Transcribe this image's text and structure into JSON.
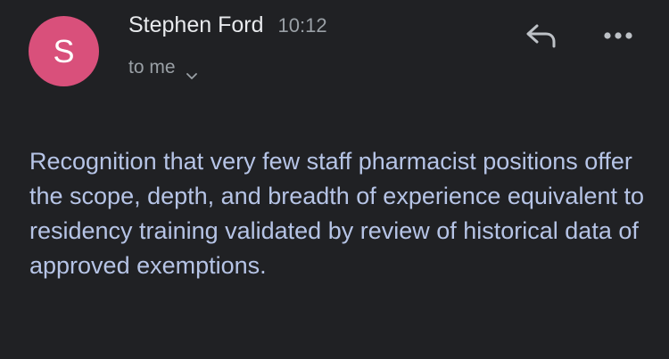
{
  "message": {
    "sender": {
      "initial": "S",
      "name": "Stephen Ford",
      "avatar_color": "#d9507b"
    },
    "time": "10:12",
    "recipient": "to me",
    "body": "Recognition that very few staff pharmacist positions offer the scope, depth, and breadth of experience equivalent to residency training validated by review of historical data of approved exemptions."
  },
  "actions": {
    "reply_icon": "reply-icon",
    "more_icon": "more-options-icon"
  },
  "colors": {
    "background": "#202124",
    "name": "#e8eaed",
    "secondary": "#9aa0a6",
    "body_text": "#b6c4e6"
  }
}
